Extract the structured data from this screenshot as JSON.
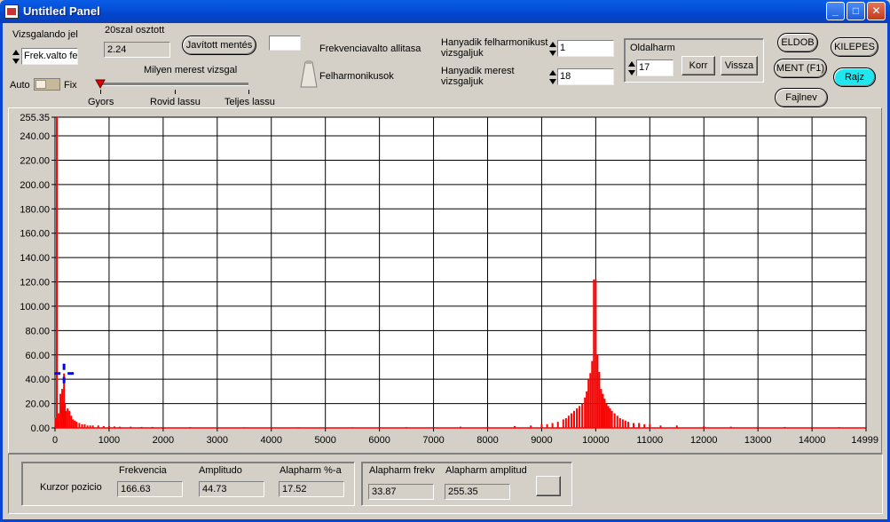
{
  "window": {
    "title": "Untitled Panel"
  },
  "controls": {
    "vizsgalando_label": "Vizsgalando jel",
    "vizsgalando_value": "Frek.valto fe",
    "osztott_label": "20szal osztott",
    "osztott_value": "2.24",
    "javitott_button": "Javított mentés",
    "small_box_value": "",
    "frekvencia_label": "Frekvenciavalto allitasa",
    "felharmonikusok_label": "Felharmonikusok",
    "milyen_label": "Milyen merest vizsgal",
    "slider_ticks": [
      "Gyors",
      "Rovid lassu",
      "Teljes lassu"
    ],
    "slider_value": 0,
    "auto_label": "Auto",
    "fix_label": "Fix",
    "hanyadik_felh_label_1": "Hanyadik felharmonikust",
    "hanyadik_felh_label_2": "vizsgaljuk",
    "hanyadik_felh_value": "1",
    "hanyadik_meres_label_1": "Hanyadik merest",
    "hanyadik_meres_label_2": "vizsgaljuk",
    "hanyadik_meres_value": "18",
    "oldalharm_label": "Oldalharm",
    "oldalharm_value": "17",
    "korr_button": "Korr",
    "vissza_button": "Vissza",
    "eldob_button": "ELDOB",
    "kilepes_button": "KILEPES",
    "ment_button": "MENT (F1)",
    "rajz_button": "Rajz",
    "fajlnev_button": "Fajlnev"
  },
  "chart_data": {
    "type": "bar",
    "title": "",
    "xlabel": "",
    "ylabel": "",
    "xlim": [
      0,
      14999
    ],
    "ylim": [
      0,
      255.35
    ],
    "x_ticks": [
      0,
      1000,
      2000,
      3000,
      4000,
      5000,
      6000,
      7000,
      8000,
      9000,
      10000,
      11000,
      12000,
      13000,
      14000,
      14999
    ],
    "y_ticks": [
      "0.00",
      "20.00",
      "40.00",
      "60.00",
      "80.00",
      "100.00",
      "120.00",
      "140.00",
      "160.00",
      "180.00",
      "200.00",
      "220.00",
      "240.00",
      "255.35"
    ],
    "grid": true,
    "series_color": "#ff0000",
    "cursor": {
      "x": 166.63,
      "y": 44.73,
      "color": "#0000ff"
    },
    "series": [
      {
        "name": "",
        "points": [
          [
            10,
            8
          ],
          [
            33.87,
            255.35
          ],
          [
            50,
            6
          ],
          [
            67,
            12
          ],
          [
            100,
            28
          ],
          [
            120,
            18
          ],
          [
            133,
            32
          ],
          [
            150,
            22
          ],
          [
            166.63,
            44.73
          ],
          [
            183,
            20
          ],
          [
            200,
            14
          ],
          [
            233,
            16
          ],
          [
            267,
            14
          ],
          [
            300,
            10
          ],
          [
            333,
            7
          ],
          [
            367,
            6
          ],
          [
            400,
            5
          ],
          [
            450,
            4
          ],
          [
            500,
            3
          ],
          [
            550,
            3
          ],
          [
            600,
            2
          ],
          [
            650,
            2
          ],
          [
            700,
            2
          ],
          [
            800,
            2
          ],
          [
            900,
            1.5
          ],
          [
            1000,
            1.5
          ],
          [
            1100,
            1.2
          ],
          [
            1200,
            1
          ],
          [
            1400,
            1
          ],
          [
            1600,
            0.8
          ],
          [
            1800,
            0.8
          ],
          [
            2000,
            0.8
          ],
          [
            2500,
            0.6
          ],
          [
            3000,
            0.6
          ],
          [
            3500,
            0.5
          ],
          [
            4000,
            0.5
          ],
          [
            4500,
            0.5
          ],
          [
            5000,
            0.5
          ],
          [
            5500,
            0.5
          ],
          [
            6000,
            0.6
          ],
          [
            6500,
            0.6
          ],
          [
            7000,
            0.8
          ],
          [
            7500,
            1
          ],
          [
            8000,
            1
          ],
          [
            8500,
            1.5
          ],
          [
            8800,
            2
          ],
          [
            9000,
            3
          ],
          [
            9100,
            3
          ],
          [
            9200,
            4
          ],
          [
            9300,
            5
          ],
          [
            9400,
            7
          ],
          [
            9450,
            8
          ],
          [
            9500,
            10
          ],
          [
            9550,
            12
          ],
          [
            9600,
            14
          ],
          [
            9650,
            16
          ],
          [
            9700,
            18
          ],
          [
            9750,
            20
          ],
          [
            9800,
            25
          ],
          [
            9833,
            30
          ],
          [
            9866,
            40
          ],
          [
            9900,
            45
          ],
          [
            9933,
            55
          ],
          [
            9966,
            122
          ],
          [
            10000,
            122
          ],
          [
            10033,
            60
          ],
          [
            10066,
            46
          ],
          [
            10100,
            32
          ],
          [
            10133,
            28
          ],
          [
            10166,
            24
          ],
          [
            10200,
            20
          ],
          [
            10233,
            18
          ],
          [
            10266,
            16
          ],
          [
            10300,
            14
          ],
          [
            10350,
            12
          ],
          [
            10400,
            10
          ],
          [
            10450,
            8
          ],
          [
            10500,
            7
          ],
          [
            10550,
            6
          ],
          [
            10600,
            5
          ],
          [
            10700,
            4
          ],
          [
            10800,
            4
          ],
          [
            10900,
            3
          ],
          [
            11000,
            3
          ],
          [
            11200,
            2
          ],
          [
            11500,
            2
          ],
          [
            12000,
            1.5
          ],
          [
            12500,
            1
          ],
          [
            13000,
            1
          ],
          [
            13500,
            0.8
          ],
          [
            14000,
            0.8
          ],
          [
            14500,
            0.6
          ],
          [
            14999,
            0.5
          ]
        ]
      }
    ]
  },
  "bottom": {
    "kurzor_label": "Kurzor pozicio",
    "frekvencia_head": "Frekvencia",
    "amplitudo_head": "Amplitudo",
    "alapharm_pct_head": "Alapharm %-a",
    "frekvencia_value": "166.63",
    "amplitudo_value": "44.73",
    "alapharm_pct_value": "17.52",
    "alapharm_frekv_head": "Alapharm frekv",
    "alapharm_amp_head": "Alapharm amplitud",
    "alapharm_frekv_value": "33.87",
    "alapharm_amp_value": "255.35"
  }
}
